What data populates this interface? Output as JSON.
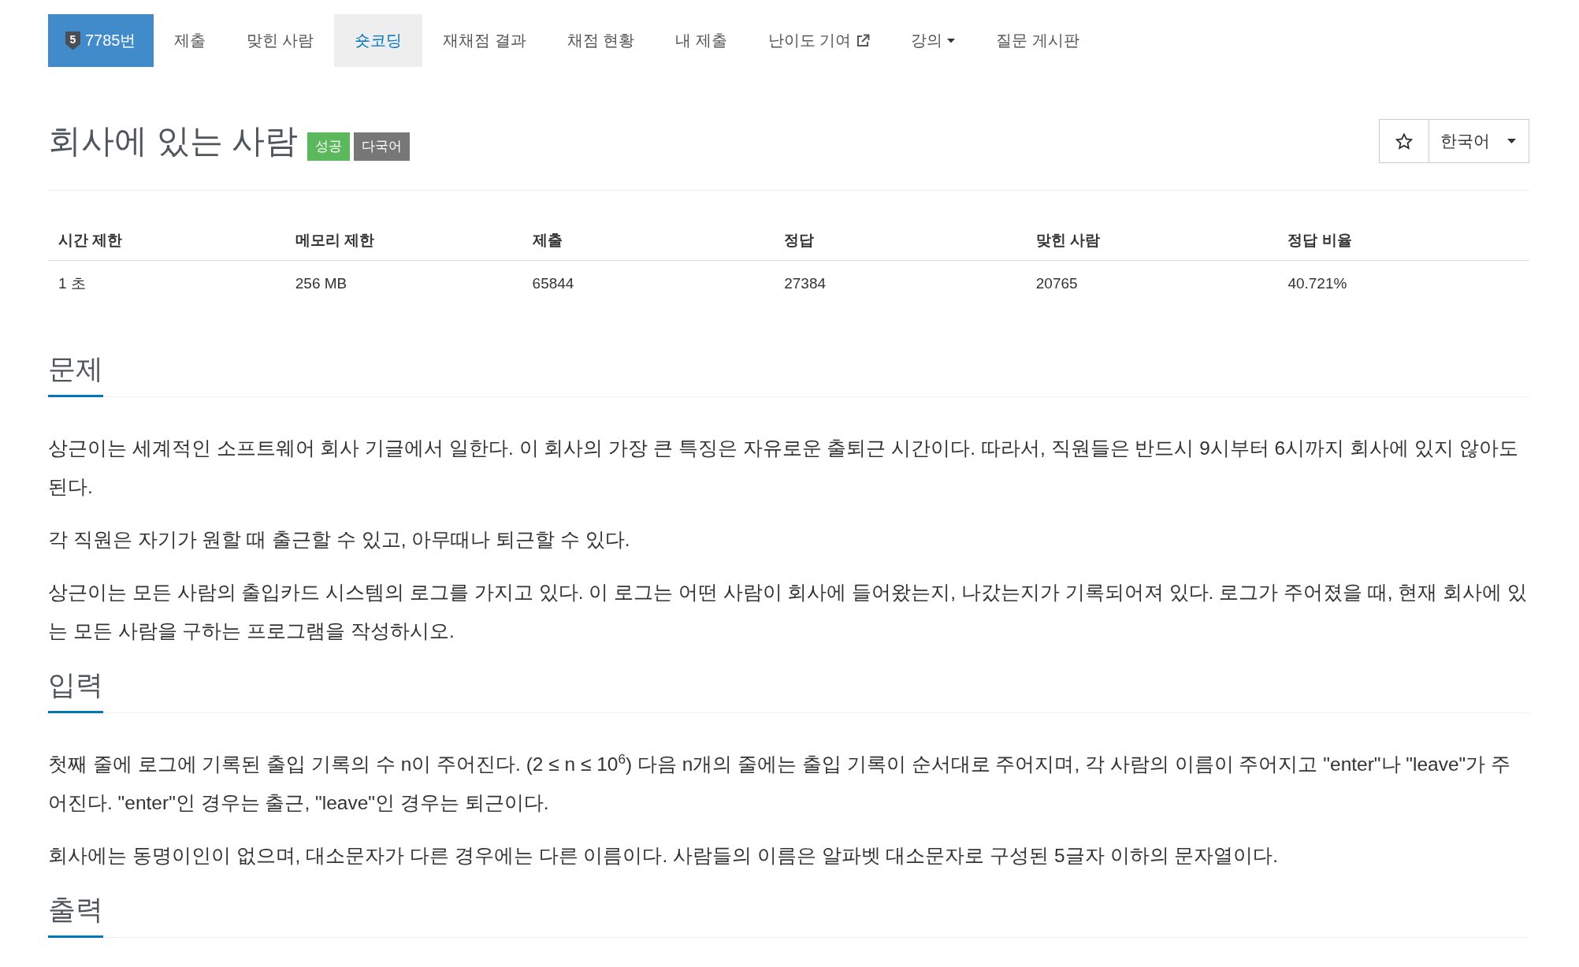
{
  "nav": {
    "tabs": [
      {
        "kind": "problem",
        "badge": "5",
        "label": "7785번",
        "selected": false
      },
      {
        "kind": "link",
        "label": "제출",
        "selected": false
      },
      {
        "kind": "link",
        "label": "맞힌 사람",
        "selected": false
      },
      {
        "kind": "link",
        "label": "숏코딩",
        "selected": true
      },
      {
        "kind": "link",
        "label": "재채점 결과",
        "selected": false
      },
      {
        "kind": "link",
        "label": "채점 현황",
        "selected": false
      },
      {
        "kind": "link",
        "label": "내 제출",
        "selected": false
      },
      {
        "kind": "external",
        "label": "난이도 기여",
        "selected": false
      },
      {
        "kind": "dropdown",
        "label": "강의",
        "selected": false
      },
      {
        "kind": "link",
        "label": "질문 게시판",
        "selected": false
      }
    ]
  },
  "problem": {
    "title": "회사에 있는 사람",
    "tags": [
      {
        "text": "성공",
        "color": "#5cb85c"
      },
      {
        "text": "다국어",
        "color": "#777777"
      }
    ],
    "language": "한국어"
  },
  "stats": {
    "columns": [
      "시간 제한",
      "메모리 제한",
      "제출",
      "정답",
      "맞힌 사람",
      "정답 비율"
    ],
    "rows": [
      [
        "1 초",
        "256 MB",
        "65844",
        "27384",
        "20765",
        "40.721%"
      ]
    ]
  },
  "sections": [
    {
      "title": "문제",
      "paragraphs": [
        "상근이는 세계적인 소프트웨어 회사 기글에서 일한다. 이 회사의 가장 큰 특징은 자유로운 출퇴근 시간이다. 따라서, 직원들은 반드시 9시부터 6시까지 회사에 있지 않아도 된다.",
        "각 직원은 자기가 원할 때 출근할 수 있고, 아무때나 퇴근할 수 있다.",
        "상근이는 모든 사람의 출입카드 시스템의 로그를 가지고 있다. 이 로그는 어떤 사람이 회사에 들어왔는지, 나갔는지가 기록되어져 있다. 로그가 주어졌을 때, 현재 회사에 있는 모든 사람을 구하는 프로그램을 작성하시오."
      ]
    },
    {
      "title": "입력",
      "paragraphs": [
        "첫째 줄에 로그에 기록된 출입 기록의 수 n이 주어진다. (2 ≤ n ≤ 10$^{6}$) 다음 n개의 줄에는 출입 기록이 순서대로 주어지며, 각 사람의 이름이 주어지고 \"enter\"나 \"leave\"가 주어진다. \"enter\"인 경우는 출근, \"leave\"인 경우는 퇴근이다.",
        "회사에는 동명이인이 없으며, 대소문자가 다른 경우에는 다른 이름이다. 사람들의 이름은 알파벳 대소문자로 구성된 5글자 이하의 문자열이다."
      ]
    },
    {
      "title": "출력"
    }
  ]
}
